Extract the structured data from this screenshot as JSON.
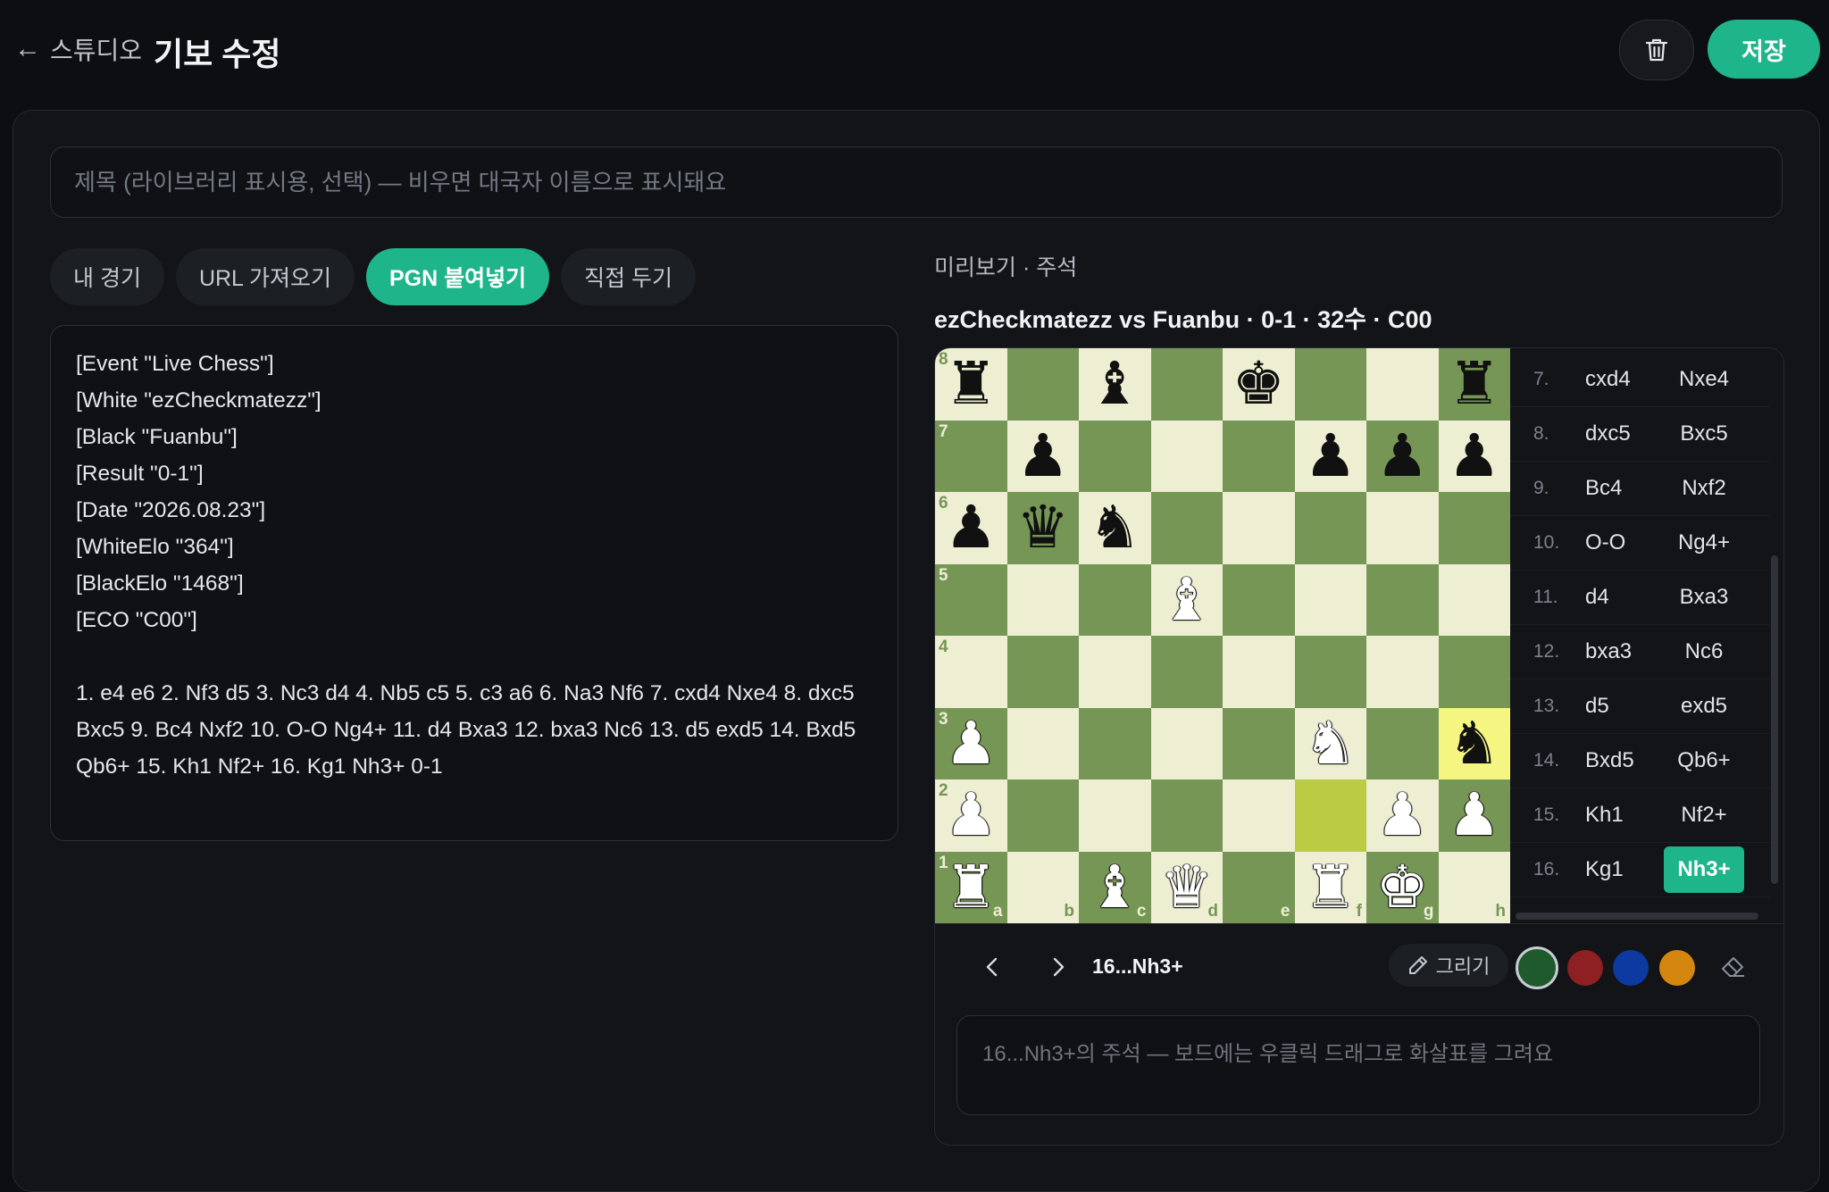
{
  "header": {
    "back_label": "스튜디오",
    "title": "기보 수정",
    "save_label": "저장"
  },
  "title_input": {
    "placeholder": "제목 (라이브러리 표시용, 선택) — 비우면 대국자 이름으로 표시돼요",
    "value": ""
  },
  "tabs": [
    {
      "label": "내 경기",
      "active": false
    },
    {
      "label": "URL 가져오기",
      "active": false
    },
    {
      "label": "PGN 붙여넣기",
      "active": true
    },
    {
      "label": "직접 두기",
      "active": false
    }
  ],
  "pgn": {
    "headers": [
      "[Event \"Live Chess\"]",
      "[White \"ezCheckmatezz\"]",
      "[Black \"Fuanbu\"]",
      "[Result \"0-1\"]",
      "[Date \"2026.08.23\"]",
      "[WhiteElo \"364\"]",
      "[BlackElo \"1468\"]",
      "[ECO \"C00\"]"
    ],
    "movetext": "1. e4 e6 2. Nf3 d5 3. Nc3 d4 4. Nb5 c5 5. c3 a6 6. Na3 Nf6 7. cxd4 Nxe4 8. dxc5 Bxc5 9. Bc4 Nxf2 10. O-O Ng4+ 11. d4 Bxa3 12. bxa3 Nc6 13. d5 exd5 14. Bxd5 Qb6+ 15. Kh1 Nf2+ 16. Kg1 Nh3+ 0-1"
  },
  "preview": {
    "label": "미리보기 · 주석",
    "game_info": "ezCheckmatezz vs Fuanbu · 0-1 · 32수 · C00"
  },
  "board": {
    "ranks": [
      "8",
      "7",
      "6",
      "5",
      "4",
      "3",
      "2",
      "1"
    ],
    "files": [
      "a",
      "b",
      "c",
      "d",
      "e",
      "f",
      "g",
      "h"
    ],
    "position": [
      [
        "r",
        "",
        "b",
        "",
        "k",
        "",
        "",
        "r"
      ],
      [
        "",
        "p",
        "",
        "",
        "",
        "p",
        "p",
        "p"
      ],
      [
        "p",
        "q",
        "n",
        "",
        "",
        "",
        "",
        ""
      ],
      [
        "",
        "",
        "",
        "B",
        "",
        "",
        "",
        ""
      ],
      [
        "",
        "",
        "",
        "",
        "",
        "",
        "",
        ""
      ],
      [
        "P",
        "",
        "",
        "",
        "",
        "N",
        "",
        "n"
      ],
      [
        "P",
        "",
        "",
        "",
        "",
        "",
        "P",
        "P"
      ],
      [
        "R",
        "",
        "B",
        "Q",
        "",
        "R",
        "K",
        ""
      ]
    ],
    "highlight": [
      "h3",
      "f2"
    ]
  },
  "move_list": [
    {
      "num": "7.",
      "white": "cxd4",
      "black": "Nxe4"
    },
    {
      "num": "8.",
      "white": "dxc5",
      "black": "Bxc5"
    },
    {
      "num": "9.",
      "white": "Bc4",
      "black": "Nxf2"
    },
    {
      "num": "10.",
      "white": "O-O",
      "black": "Ng4+"
    },
    {
      "num": "11.",
      "white": "d4",
      "black": "Bxa3"
    },
    {
      "num": "12.",
      "white": "bxa3",
      "black": "Nc6"
    },
    {
      "num": "13.",
      "white": "d5",
      "black": "exd5"
    },
    {
      "num": "14.",
      "white": "Bxd5",
      "black": "Qb6+"
    },
    {
      "num": "15.",
      "white": "Kh1",
      "black": "Nf2+"
    },
    {
      "num": "16.",
      "white": "Kg1",
      "black": "Nh3+",
      "active_black": true
    }
  ],
  "controls": {
    "prev_icon": "chevron-left-icon",
    "next_icon": "chevron-right-icon",
    "current_move": "16...Nh3+",
    "draw_label": "그리기",
    "colors": [
      "#1e5a2c",
      "#8e1f22",
      "#0c3aa0",
      "#d4860f"
    ],
    "selected_color_index": 0
  },
  "note": {
    "placeholder": "16...Nh3+의 주석 — 보드에는 우클릭 드래그로 화살표를 그려요",
    "value": ""
  },
  "colors": {
    "accent": "#1fb58a",
    "light_square": "#eeeed2",
    "dark_square": "#769656"
  }
}
